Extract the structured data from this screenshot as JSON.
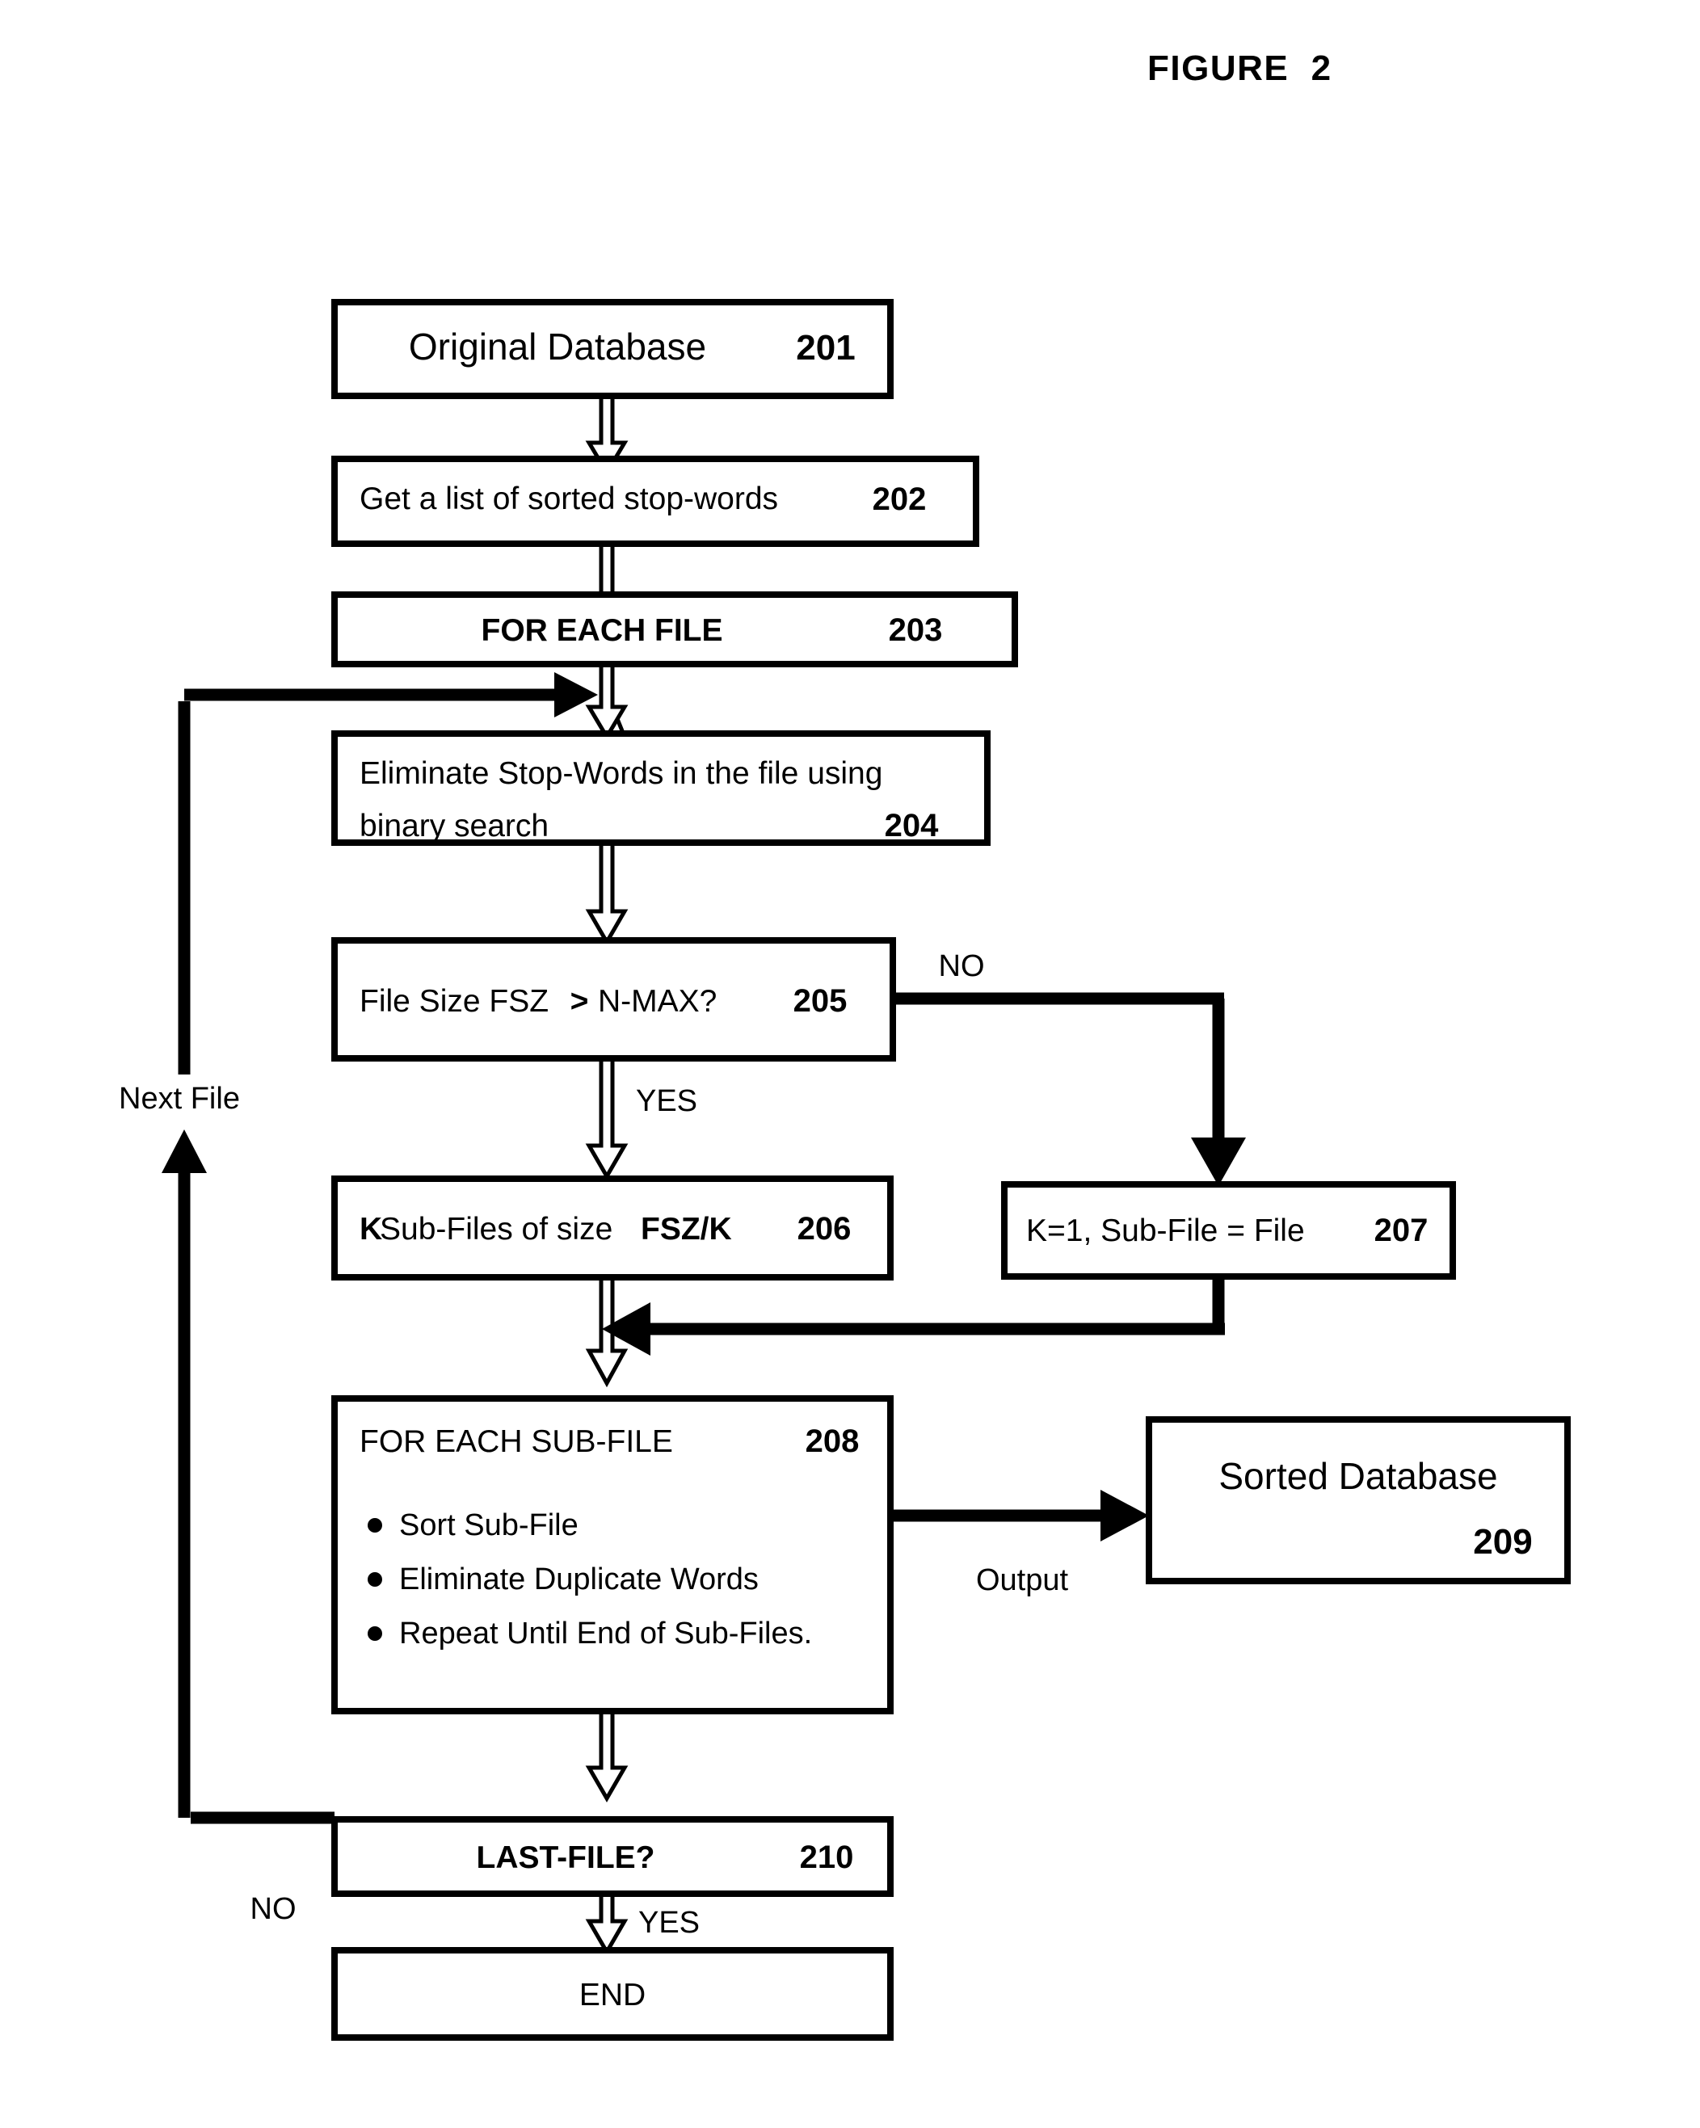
{
  "figure": {
    "title": "FIGURE  2"
  },
  "nodes": {
    "n201": {
      "text": "Original Database",
      "ref": "201"
    },
    "n202": {
      "text": "Get a list of sorted stop-words",
      "ref": "202"
    },
    "n203": {
      "text": "FOR EACH FILE",
      "ref": "203"
    },
    "n204": {
      "line1": "Eliminate Stop-Words in the file using",
      "line2": "binary search",
      "ref": "204"
    },
    "n205": {
      "part1": "File Size FSZ ",
      "op": ">",
      "part2": " N-MAX?",
      "ref": "205"
    },
    "n206": {
      "k": "K",
      "mid": " Sub-Files of size ",
      "expr": "FSZ/K",
      "ref": "206"
    },
    "n207": {
      "text": "K=1,  Sub-File = File",
      "ref": "207"
    },
    "n208": {
      "header": "FOR EACH SUB-FILE",
      "ref": "208",
      "bullets": [
        "Sort Sub-File",
        "Eliminate Duplicate Words",
        "Repeat Until End of Sub-Files."
      ]
    },
    "n209": {
      "text": "Sorted Database",
      "ref": "209"
    },
    "n210": {
      "text": "LAST-FILE?",
      "ref": "210"
    },
    "nEnd": {
      "text": "END"
    }
  },
  "edge_labels": {
    "next_file": "Next File",
    "no_205": "NO",
    "yes_205": "YES",
    "output": "Output",
    "no_210": "NO",
    "yes_210": "YES"
  },
  "colors": {
    "stroke": "#000000",
    "fill": "#ffffff",
    "background": "#ffffff"
  }
}
